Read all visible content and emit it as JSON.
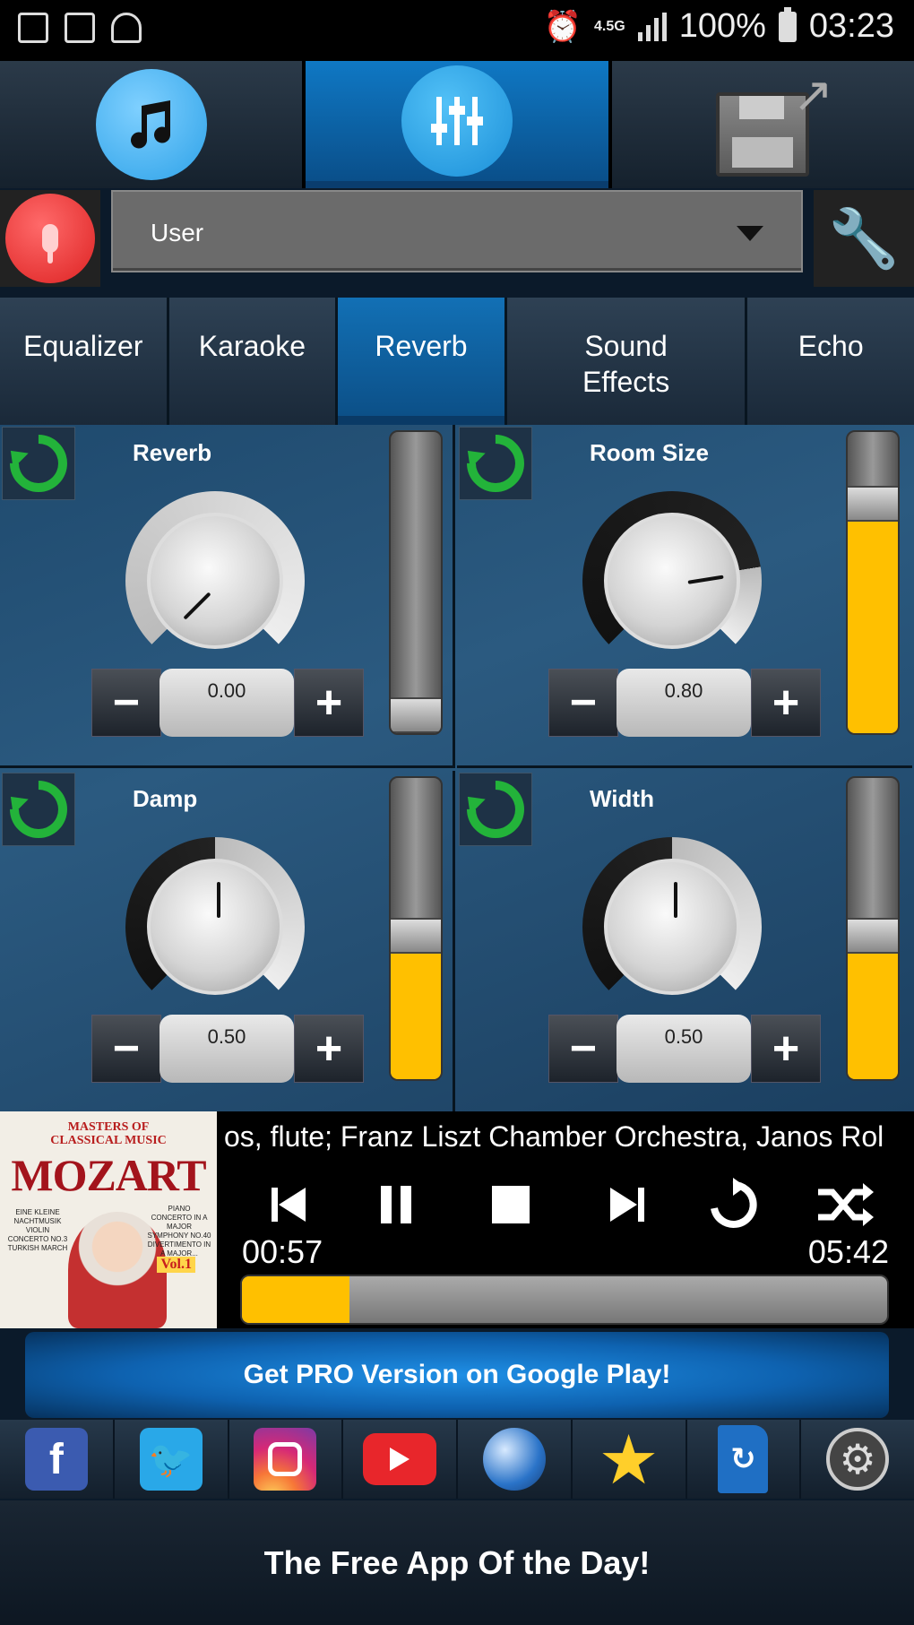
{
  "status_bar": {
    "network": "4.5G",
    "battery": "100%",
    "time": "03:23"
  },
  "preset": {
    "selected": "User"
  },
  "effect_tabs": [
    {
      "label": "Equalizer"
    },
    {
      "label": "Karaoke"
    },
    {
      "label": "Reverb"
    },
    {
      "label": "Sound Effects"
    },
    {
      "label": "Echo"
    }
  ],
  "panels": [
    {
      "title": "Reverb",
      "value": "0.00",
      "level": 0.0
    },
    {
      "title": "Room Size",
      "value": "0.80",
      "level": 0.8
    },
    {
      "title": "Damp",
      "value": "0.50",
      "level": 0.5
    },
    {
      "title": "Width",
      "value": "0.50",
      "level": 0.5
    }
  ],
  "player": {
    "track_text": "os, flute; Franz Liszt Chamber Orchestra, Janos Rol",
    "elapsed": "00:57",
    "duration": "05:42",
    "progress": 0.166,
    "album": {
      "line1": "MASTERS OF",
      "line2": "CLASSICAL MUSIC",
      "title": "MOZART",
      "left_text": "EINE KLEINE NACHTMUSIK VIOLIN CONCERTO NO.3 TURKISH MARCH",
      "right_text": "PIANO CONCERTO IN A MAJOR SYMPHONY NO.40 DIVERTIMENTO IN A MAJOR...",
      "vol": "Vol.1"
    }
  },
  "pro_banner": "Get PRO Version on Google Play!",
  "footer_text": "The Free App Of the Day!",
  "colors": {
    "accent_yellow": "#ffc000",
    "active_tab": "#1270b5",
    "reset_green": "#23b33a"
  }
}
